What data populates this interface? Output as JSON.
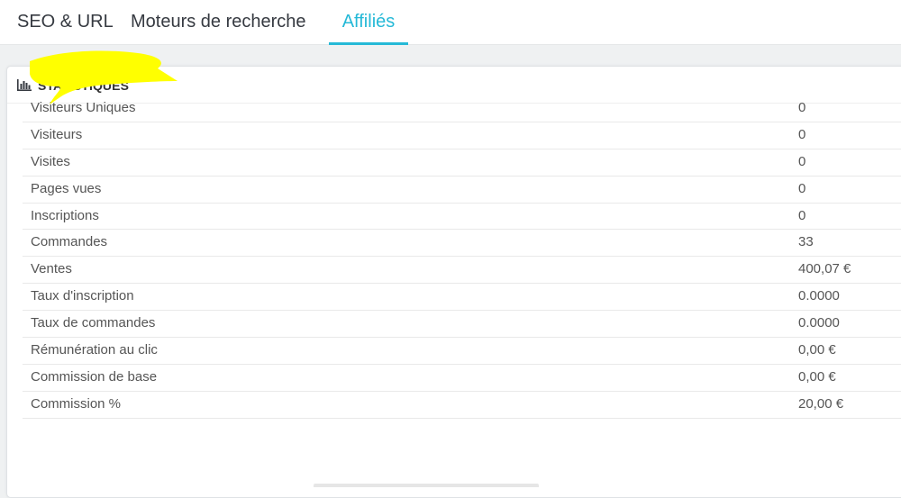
{
  "tabs": [
    {
      "label": "SEO & URL"
    },
    {
      "label": "Moteurs de recherche"
    },
    {
      "label": "Affiliés",
      "active": true
    }
  ],
  "panel": {
    "icon": "bar-chart-icon",
    "title": "STATISTIQUES"
  },
  "stats": [
    {
      "label": "Visiteurs Uniques",
      "value": "0"
    },
    {
      "label": "Visiteurs",
      "value": "0"
    },
    {
      "label": "Visites",
      "value": "0"
    },
    {
      "label": "Pages vues",
      "value": "0"
    },
    {
      "label": "Inscriptions",
      "value": "0"
    },
    {
      "label": "Commandes",
      "value": "33"
    },
    {
      "label": "Ventes",
      "value": "400,07 €"
    },
    {
      "label": "Taux d'inscription",
      "value": "0.0000"
    },
    {
      "label": "Taux de commandes",
      "value": "0.0000"
    },
    {
      "label": "Rémunération au clic",
      "value": "0,00 €"
    },
    {
      "label": "Commission de base",
      "value": "0,00 €"
    },
    {
      "label": "Commission %",
      "value": "20,00 €"
    }
  ],
  "colors": {
    "accent": "#25b9d7",
    "redaction": "#ffff00"
  }
}
